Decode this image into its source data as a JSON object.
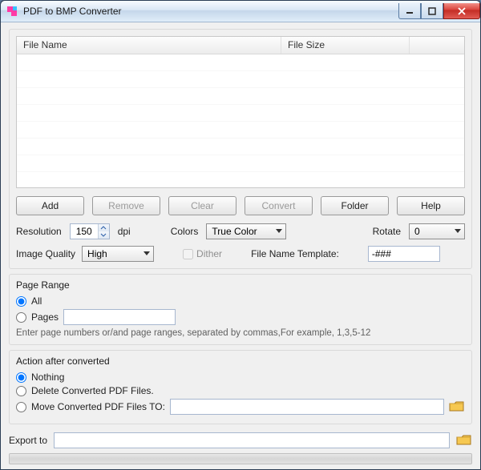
{
  "window": {
    "title": "PDF to BMP Converter"
  },
  "filelist": {
    "col_name": "File Name",
    "col_size": "File Size"
  },
  "buttons": {
    "add": "Add",
    "remove": "Remove",
    "clear": "Clear",
    "convert": "Convert",
    "folder": "Folder",
    "help": "Help"
  },
  "settings": {
    "resolution_label": "Resolution",
    "resolution_value": "150",
    "dpi_label": "dpi",
    "colors_label": "Colors",
    "colors_value": "True Color",
    "rotate_label": "Rotate",
    "rotate_value": "0",
    "image_quality_label": "Image Quality",
    "image_quality_value": "High",
    "dither_label": "Dither",
    "filename_template_label": "File Name Template:",
    "filename_template_value": "-###"
  },
  "page_range": {
    "legend": "Page Range",
    "all_label": "All",
    "pages_label": "Pages",
    "pages_value": "",
    "hint": "Enter page numbers or/and page ranges, separated by commas,For example, 1,3,5-12"
  },
  "action": {
    "legend": "Action after converted",
    "nothing_label": "Nothing",
    "delete_label": "Delete Converted PDF Files.",
    "move_label": "Move Converted PDF Files TO:",
    "move_path": ""
  },
  "export": {
    "label": "Export to",
    "value": ""
  }
}
